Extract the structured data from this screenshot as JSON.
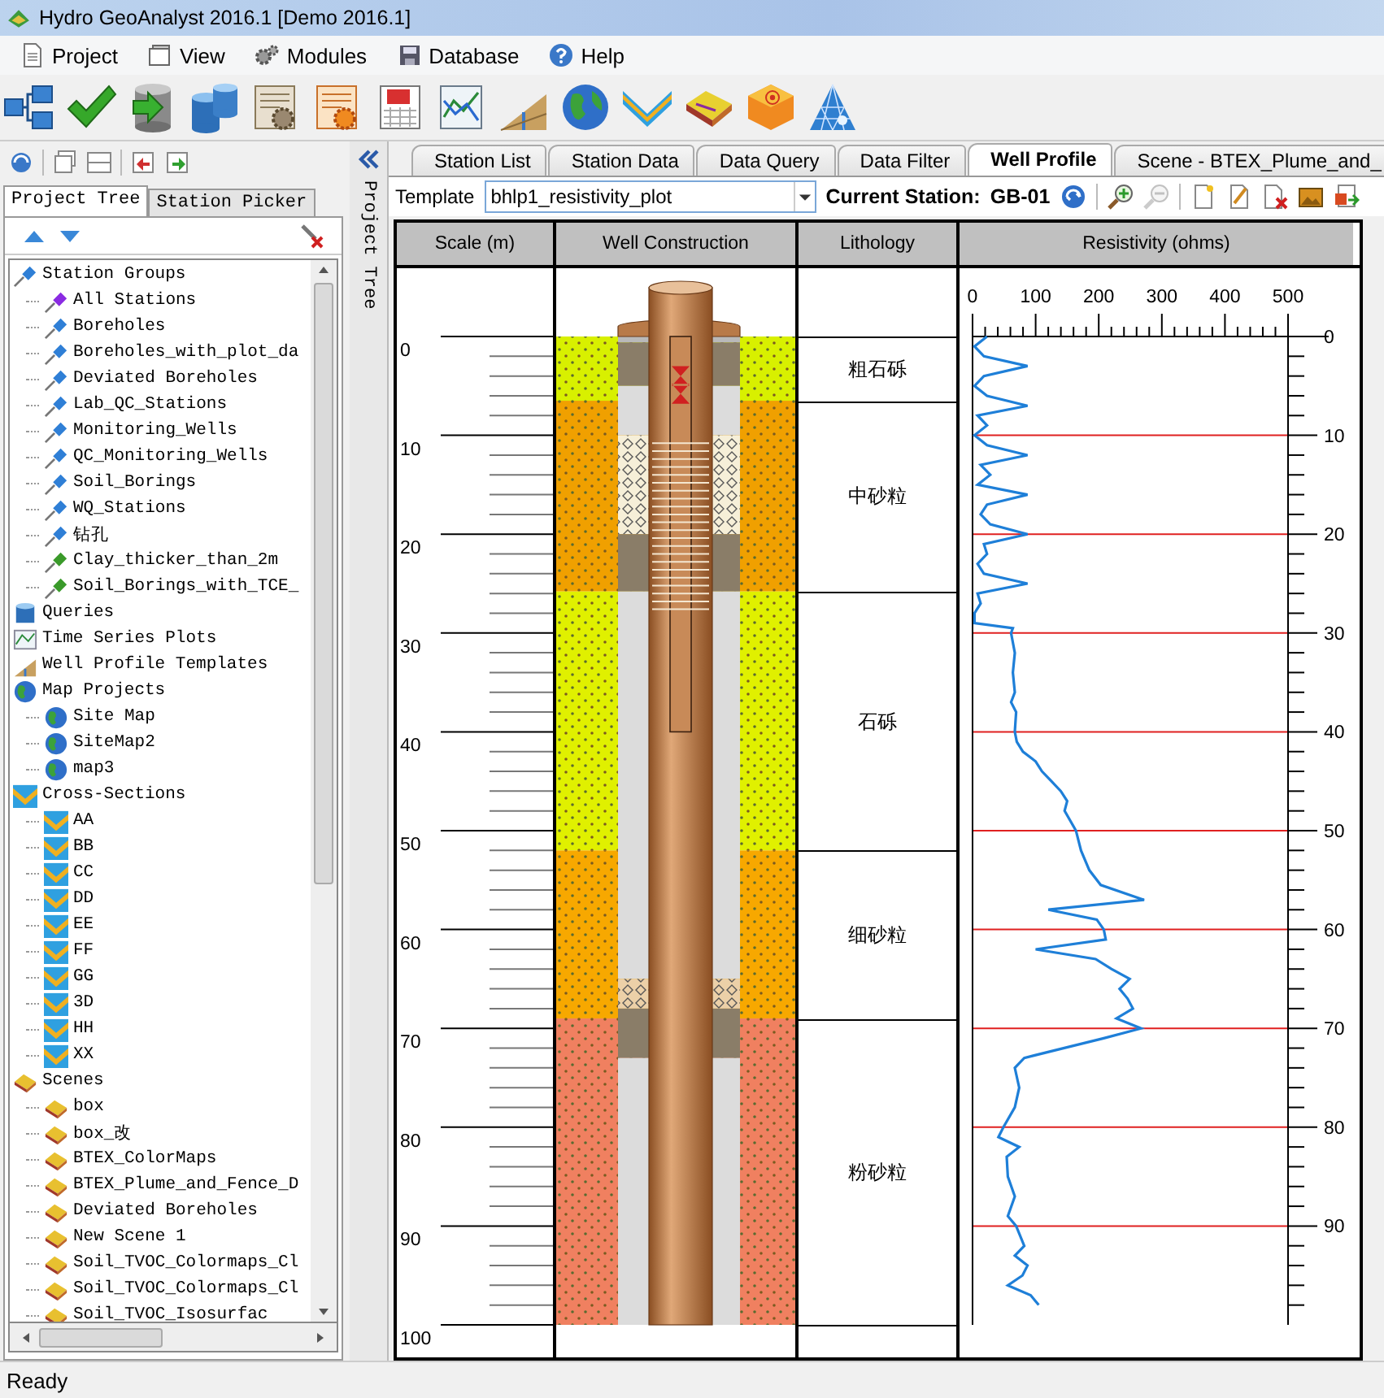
{
  "window": {
    "title": "Hydro GeoAnalyst 2016.1 [Demo 2016.1]"
  },
  "menu": [
    "Project",
    "View",
    "Modules",
    "Database",
    "Help"
  ],
  "left_panel": {
    "tabs": [
      {
        "label": "Project Tree",
        "selected": true
      },
      {
        "label": "Station Picker",
        "selected": false
      }
    ],
    "tree": [
      {
        "label": "Station Groups",
        "kind": "pin",
        "color": "#2f7fd6",
        "children": [
          {
            "label": "All Stations",
            "kind": "pin",
            "color": "#8a2be2"
          },
          {
            "label": "Boreholes",
            "kind": "pin",
            "color": "#2f7fd6"
          },
          {
            "label": "Boreholes_with_plot_da",
            "kind": "pin",
            "color": "#2f7fd6"
          },
          {
            "label": "Deviated Boreholes",
            "kind": "pin",
            "color": "#2f7fd6"
          },
          {
            "label": "Lab_QC_Stations",
            "kind": "pin",
            "color": "#2f7fd6"
          },
          {
            "label": "Monitoring_Wells",
            "kind": "pin",
            "color": "#2f7fd6"
          },
          {
            "label": "QC_Monitoring_Wells",
            "kind": "pin",
            "color": "#2f7fd6"
          },
          {
            "label": "Soil_Borings",
            "kind": "pin",
            "color": "#2f7fd6"
          },
          {
            "label": "WQ_Stations",
            "kind": "pin",
            "color": "#2f7fd6"
          },
          {
            "label": "钻孔",
            "kind": "pin",
            "color": "#2f7fd6"
          },
          {
            "label": "Clay_thicker_than_2m",
            "kind": "pin",
            "color": "#3a9a2a"
          },
          {
            "label": "Soil_Borings_with_TCE_",
            "kind": "pin",
            "color": "#3a9a2a"
          }
        ]
      },
      {
        "label": "Queries",
        "kind": "queries"
      },
      {
        "label": "Time Series Plots",
        "kind": "plot"
      },
      {
        "label": "Well Profile Templates",
        "kind": "template"
      },
      {
        "label": "Map Projects",
        "kind": "globe",
        "children": [
          {
            "label": "Site Map",
            "kind": "globe"
          },
          {
            "label": "SiteMap2",
            "kind": "globe"
          },
          {
            "label": "map3",
            "kind": "globe"
          }
        ]
      },
      {
        "label": "Cross-Sections",
        "kind": "section",
        "children": [
          {
            "label": "AA",
            "kind": "section"
          },
          {
            "label": "BB",
            "kind": "section"
          },
          {
            "label": "CC",
            "kind": "section"
          },
          {
            "label": "DD",
            "kind": "section"
          },
          {
            "label": "EE",
            "kind": "section"
          },
          {
            "label": "FF",
            "kind": "section"
          },
          {
            "label": "GG",
            "kind": "section"
          },
          {
            "label": "3D",
            "kind": "section"
          },
          {
            "label": "HH",
            "kind": "section"
          },
          {
            "label": "XX",
            "kind": "section"
          }
        ]
      },
      {
        "label": "Scenes",
        "kind": "scene",
        "children": [
          {
            "label": "box",
            "kind": "scene"
          },
          {
            "label": "box_改",
            "kind": "scene"
          },
          {
            "label": "BTEX_ColorMaps",
            "kind": "scene"
          },
          {
            "label": "BTEX_Plume_and_Fence_D",
            "kind": "scene"
          },
          {
            "label": "Deviated Boreholes",
            "kind": "scene"
          },
          {
            "label": "New Scene 1",
            "kind": "scene"
          },
          {
            "label": "Soil_TVOC_Colormaps_Cl",
            "kind": "scene"
          },
          {
            "label": "Soil_TVOC_Colormaps_Cl",
            "kind": "scene"
          },
          {
            "label": "Soil_TVOC_Isosurfac",
            "kind": "scene"
          }
        ]
      }
    ]
  },
  "side_strip": {
    "label": "Project Tree"
  },
  "tabs": [
    {
      "label": "Station List",
      "selected": false
    },
    {
      "label": "Station Data",
      "selected": false
    },
    {
      "label": "Data Query",
      "selected": false
    },
    {
      "label": "Data Filter",
      "selected": false
    },
    {
      "label": "Well Profile",
      "selected": true
    },
    {
      "label": "Scene - BTEX_Plume_and_",
      "selected": false
    }
  ],
  "template": {
    "label": "Template",
    "value": "bhlp1_resistivity_plot",
    "station_label": "Current Station:",
    "station": "GB-01"
  },
  "well_profile": {
    "columns": [
      "Scale (m)",
      "Well Construction",
      "Lithology"
    ],
    "scale_labels": [
      "0",
      "10",
      "20",
      "30",
      "40",
      "50",
      "60",
      "70",
      "80",
      "90",
      "100"
    ],
    "lithology": [
      {
        "label": "粗石砾",
        "color": "#d8f000"
      },
      {
        "label": "中砂粒",
        "color": "#f0a000"
      },
      {
        "label": "石砾",
        "color": "#e0f000"
      },
      {
        "label": "细砂粒",
        "color": "#f7a800"
      },
      {
        "label": "粉砂粒",
        "color": "#f08060"
      }
    ],
    "chart_data": {
      "type": "line",
      "title": "Resistivity (ohms)",
      "grid": true,
      "xlim": [
        0,
        500
      ],
      "ylim": [
        100,
        0
      ],
      "yticks": [
        {
          "value": 0,
          "label": "0"
        },
        {
          "value": 10,
          "label": "10"
        },
        {
          "value": 20,
          "label": "20"
        },
        {
          "value": 30,
          "label": "30"
        },
        {
          "value": 40,
          "label": "40"
        },
        {
          "value": 50,
          "label": "50"
        },
        {
          "value": 60,
          "label": "60"
        },
        {
          "value": 70,
          "label": "70"
        },
        {
          "value": 80,
          "label": "80"
        },
        {
          "value": 90,
          "label": "90"
        }
      ],
      "xticks": [
        {
          "value": 0,
          "label": "0"
        },
        {
          "value": 100,
          "label": "100"
        },
        {
          "value": 200,
          "label": "200"
        },
        {
          "value": 300,
          "label": "300"
        },
        {
          "value": 400,
          "label": "400"
        },
        {
          "value": 500,
          "label": "500"
        }
      ],
      "x": [
        23,
        3,
        18,
        87,
        18,
        3,
        23,
        87,
        8,
        23,
        3,
        23,
        87,
        13,
        28,
        8,
        87,
        23,
        13,
        28,
        87,
        18,
        23,
        8,
        18,
        87,
        8,
        13,
        3,
        3,
        64,
        61,
        67,
        64,
        67,
        61,
        69,
        67,
        70,
        80,
        100,
        110,
        125,
        140,
        150,
        146,
        164,
        172,
        185,
        203,
        272,
        120,
        197,
        208,
        211,
        100,
        195,
        220,
        249,
        233,
        246,
        254,
        228,
        267,
        208,
        144,
        82,
        67,
        74,
        67,
        49,
        41,
        74,
        54,
        56,
        67,
        56,
        69,
        82,
        67,
        87,
        79,
        56,
        92,
        105
      ],
      "series": [
        {
          "color": "#1e7fd8",
          "values": [
            0,
            1,
            2,
            3,
            4,
            5,
            6,
            7,
            8,
            9,
            10,
            11,
            12,
            13,
            14,
            15,
            16,
            17,
            18,
            19,
            20,
            21,
            22,
            23,
            24,
            25,
            26,
            27,
            28,
            29,
            29.5,
            30,
            32,
            34,
            36,
            37,
            38,
            40,
            41,
            42,
            43,
            44,
            45,
            46,
            47,
            48,
            50,
            52,
            54,
            55.5,
            57,
            58,
            59,
            60,
            61,
            62,
            63,
            64,
            65,
            66,
            67,
            68,
            69,
            70,
            71,
            72,
            73,
            74,
            76,
            78,
            80,
            81,
            82,
            83,
            85,
            87,
            89,
            90,
            92,
            93,
            94,
            95,
            96,
            97,
            98
          ]
        }
      ]
    }
  },
  "status_bar": "Ready"
}
